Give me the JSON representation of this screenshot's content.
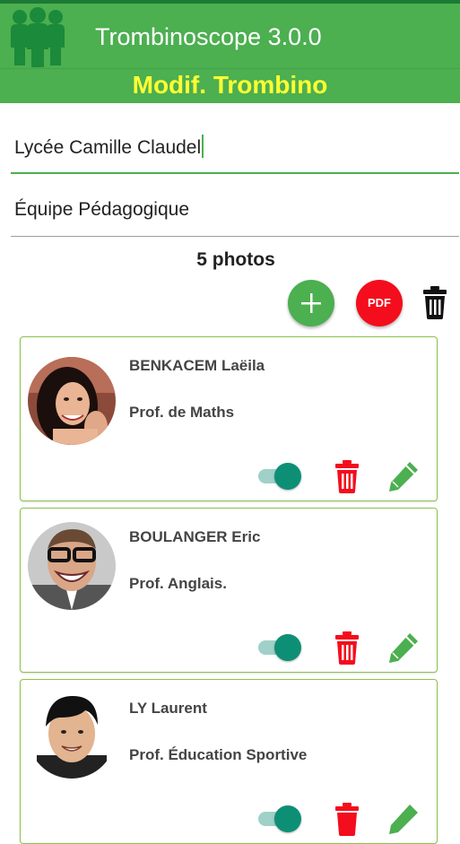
{
  "app": {
    "title": "Trombinoscope 3.0.0",
    "subtitle": "Modif. Trombino"
  },
  "form": {
    "school": "Lycée Camille Claudel",
    "team": "Équipe Pédagogique"
  },
  "photo_count_label": "5 photos",
  "actions": {
    "add_icon": "plus-icon",
    "pdf_label": "PDF",
    "delete_all_icon": "trash-icon"
  },
  "colors": {
    "primary": "#4caf50",
    "subtitle": "#ffff33",
    "danger": "#f40d1d",
    "toggle": "#0d8f76",
    "edit": "#4caf50"
  },
  "members": [
    {
      "name": "BENKACEM Laëila",
      "role": "Prof. de Maths",
      "visible": true
    },
    {
      "name": "BOULANGER Eric",
      "role": "Prof. Anglais.",
      "visible": true
    },
    {
      "name": "LY Laurent",
      "role": "Prof. Éducation Sportive",
      "visible": true
    }
  ]
}
